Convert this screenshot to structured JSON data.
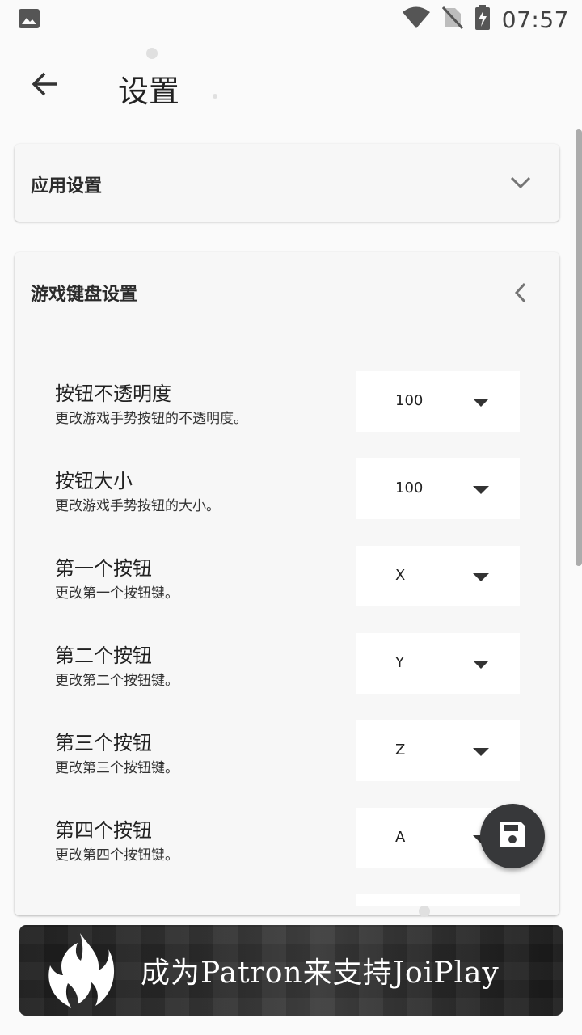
{
  "status_bar": {
    "time": "07:57",
    "icons": [
      "image-icon",
      "wifi-icon",
      "no-sim-icon",
      "battery-charging-icon"
    ]
  },
  "app_bar": {
    "back_icon": "arrow-back-icon",
    "title": "设置"
  },
  "sections": {
    "app_settings": {
      "title": "应用设置",
      "state": "collapsed"
    },
    "game_keyboard": {
      "title": "游戏键盘设置",
      "state": "expanded",
      "items": [
        {
          "title": "按钮不透明度",
          "description": "更改游戏手势按钮的不透明度。",
          "value": "100"
        },
        {
          "title": "按钮大小",
          "description": "更改游戏手势按钮的大小。",
          "value": "100"
        },
        {
          "title": "第一个按钮",
          "description": "更改第一个按钮键。",
          "value": "X"
        },
        {
          "title": "第二个按钮",
          "description": "更改第二个按钮键。",
          "value": "Y"
        },
        {
          "title": "第三个按钮",
          "description": "更改第三个按钮键。",
          "value": "Z"
        },
        {
          "title": "第四个按钮",
          "description": "更改第四个按钮键。",
          "value": "A"
        }
      ]
    }
  },
  "fab": {
    "icon": "save-icon"
  },
  "banner": {
    "text": "成为Patron来支持JoiPlay",
    "logo": "flame-logo"
  },
  "colors": {
    "background": "#fafafa",
    "card": "#f7f7f7",
    "fab": "#37383a",
    "banner": "#2a2a2a"
  }
}
